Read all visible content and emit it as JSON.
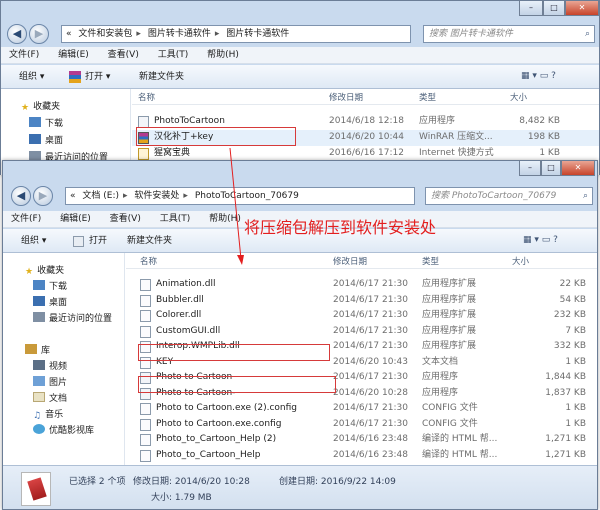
{
  "window1": {
    "controls": [
      "–",
      "□",
      "✕"
    ],
    "address_parts": [
      "«",
      "文件和安装包",
      "图片转卡通软件",
      "图片转卡通软件"
    ],
    "search_placeholder": "搜索 图片转卡通软件",
    "menu": [
      "文件(F)",
      "编辑(E)",
      "查看(V)",
      "工具(T)",
      "帮助(H)"
    ],
    "toolbar": {
      "organize": "组织 ▾",
      "open": "打开 ▾",
      "new_folder": "新建文件夹"
    },
    "nav": [
      {
        "label": "收藏夹"
      },
      {
        "label": "下载"
      },
      {
        "label": "桌面"
      },
      {
        "label": "最近访问的位置"
      }
    ],
    "columns": {
      "name": "名称",
      "date": "修改日期",
      "type": "类型",
      "size": "大小"
    },
    "files": [
      {
        "name": "PhotoToCartoon",
        "date": "2014/6/18 12:18",
        "type": "应用程序",
        "size": "8,482 KB"
      },
      {
        "name": "汉化补丁+key",
        "date": "2014/6/20 10:44",
        "type": "WinRAR 压缩文...",
        "size": "198 KB"
      },
      {
        "name": "猩窝宝典",
        "date": "2016/6/16 17:12",
        "type": "Internet 快捷方式",
        "size": "1 KB"
      }
    ]
  },
  "window2": {
    "controls": [
      "–",
      "□",
      "✕"
    ],
    "address_parts": [
      "«",
      "文档 (E:)",
      "软件安装处",
      "PhotoToCartoon_70679"
    ],
    "search_placeholder": "搜索 PhotoToCartoon_70679",
    "menu": [
      "文件(F)",
      "编辑(E)",
      "查看(V)",
      "工具(T)",
      "帮助(H)"
    ],
    "toolbar": {
      "organize": "组织 ▾",
      "open": "打开",
      "new_folder": "新建文件夹"
    },
    "nav": [
      {
        "label": "收藏夹"
      },
      {
        "label": "下载"
      },
      {
        "label": "桌面"
      },
      {
        "label": "最近访问的位置"
      },
      {
        "label": "库"
      },
      {
        "label": "视频"
      },
      {
        "label": "图片"
      },
      {
        "label": "文档"
      },
      {
        "label": "音乐"
      },
      {
        "label": "优酷影视库"
      }
    ],
    "columns": {
      "name": "名称",
      "date": "修改日期",
      "type": "类型",
      "size": "大小"
    },
    "files": [
      {
        "name": "Animation.dll",
        "date": "2014/6/17 21:30",
        "type": "应用程序扩展",
        "size": "22 KB"
      },
      {
        "name": "Bubbler.dll",
        "date": "2014/6/17 21:30",
        "type": "应用程序扩展",
        "size": "54 KB"
      },
      {
        "name": "Colorer.dll",
        "date": "2014/6/17 21:30",
        "type": "应用程序扩展",
        "size": "232 KB"
      },
      {
        "name": "CustomGUI.dll",
        "date": "2014/6/17 21:30",
        "type": "应用程序扩展",
        "size": "7 KB"
      },
      {
        "name": "Interop.WMPLib.dll",
        "date": "2014/6/17 21:30",
        "type": "应用程序扩展",
        "size": "332 KB"
      },
      {
        "name": "KEY",
        "date": "2014/6/20 10:43",
        "type": "文本文档",
        "size": "1 KB"
      },
      {
        "name": "Photo to Cartoon",
        "date": "2014/6/17 21:30",
        "type": "应用程序",
        "size": "1,844 KB"
      },
      {
        "name": "Photo to Cartoon-",
        "date": "2014/6/20 10:28",
        "type": "应用程序",
        "size": "1,837 KB"
      },
      {
        "name": "Photo to Cartoon.exe (2).config",
        "date": "2014/6/17 21:30",
        "type": "CONFIG 文件",
        "size": "1 KB"
      },
      {
        "name": "Photo to Cartoon.exe.config",
        "date": "2014/6/17 21:30",
        "type": "CONFIG 文件",
        "size": "1 KB"
      },
      {
        "name": "Photo_to_Cartoon_Help (2)",
        "date": "2014/6/16 23:48",
        "type": "编译的 HTML 帮...",
        "size": "1,271 KB"
      },
      {
        "name": "Photo_to_Cartoon_Help",
        "date": "2014/6/16 23:48",
        "type": "编译的 HTML 帮...",
        "size": "1,271 KB"
      }
    ],
    "status": {
      "selected": "已选择 2 个项",
      "modified": "修改日期: 2014/6/20 10:28",
      "created": "创建日期: 2016/9/22 14:09",
      "size": "大小: 1.79 MB"
    }
  },
  "annotation": "将压缩包解压到软件安装处",
  "colors": {
    "highlight": "#d63a3a",
    "annotation": "#e31f1f",
    "frame": "#c9daee"
  }
}
